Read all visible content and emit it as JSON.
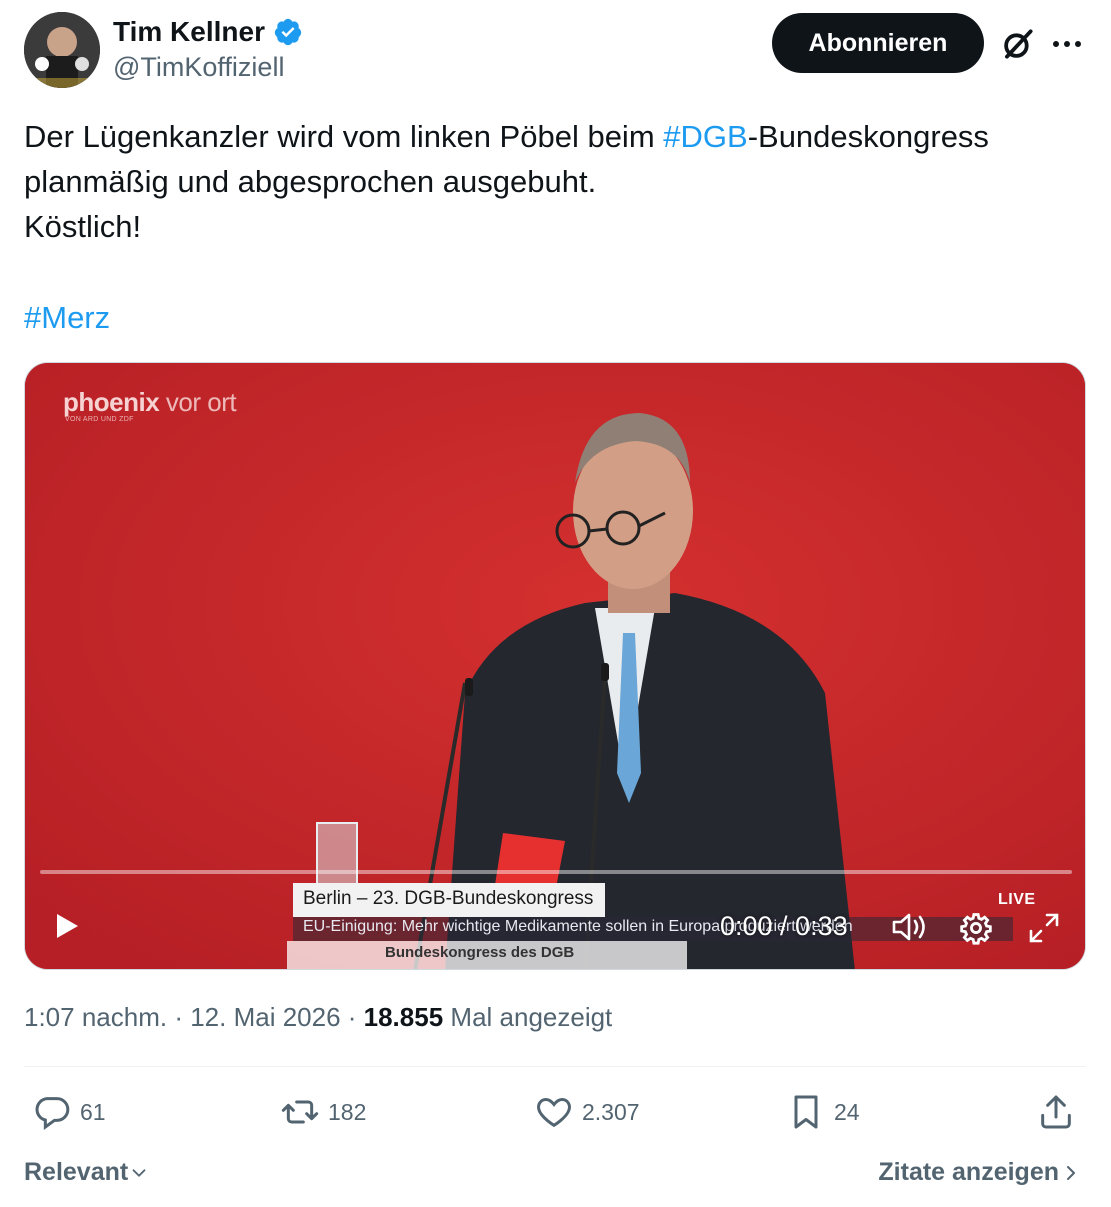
{
  "author": {
    "display_name": "Tim Kellner",
    "handle": "@TimKoffiziell",
    "verified": true
  },
  "header": {
    "subscribe_label": "Abonnieren"
  },
  "tweet": {
    "text_line1_before": "Der Lügenkanzler wird vom linken Pöbel beim ",
    "text_line1_hashtag": "#DGB",
    "text_line1_after": "-Bundeskongress",
    "text_line2": "planmäßig und abgesprochen ausgebuht.",
    "text_line3": "Köstlich!",
    "hashtag": "#Merz"
  },
  "video": {
    "channel_logo": "phoenix",
    "channel_logo_suffix": "vor ort",
    "channel_logo_sub": "VON ARD UND ZDF",
    "lower_third_title": "Berlin – 23. DGB-Bundeskongress",
    "ticker_text": "EU-Einigung: Mehr wichtige Medikamente sollen in Europa produziert werden",
    "caption_text": "Bundeskongress des DGB",
    "time_display": "0:00 / 0:33",
    "live_label": "LIVE",
    "progress": 0.0
  },
  "meta": {
    "time": "1:07 nachm.",
    "separator": " · ",
    "date": "12. Mai 2026",
    "views_count": "18.855",
    "views_label": "Mal angezeigt"
  },
  "actions": {
    "replies": "61",
    "reposts": "182",
    "likes": "2.307",
    "bookmarks": "24"
  },
  "footer": {
    "sort_label": "Relevant",
    "quotes_label": "Zitate anzeigen"
  },
  "colors": {
    "accent": "#1d9bf0",
    "text": "#0f1419",
    "secondary": "#536471",
    "video_bg": "#c8252a"
  }
}
